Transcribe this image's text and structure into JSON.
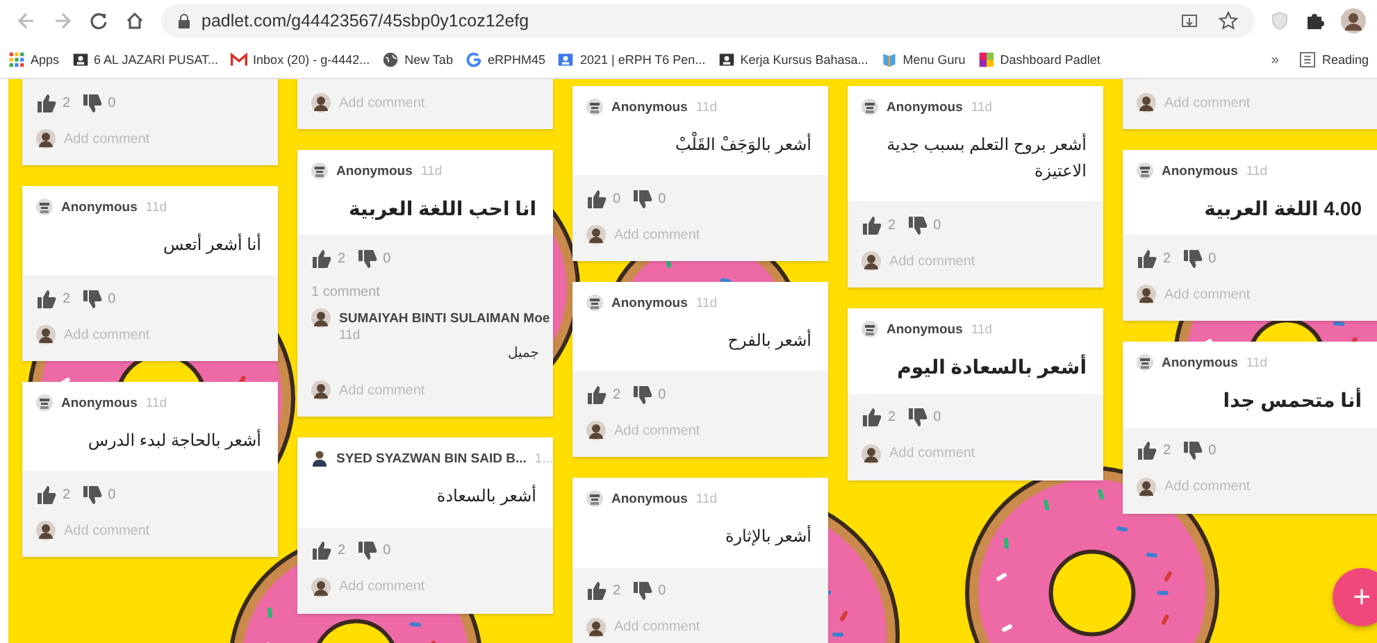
{
  "browser": {
    "url": "padlet.com/g44423567/45sbp0y1coz12efg",
    "bookmarks": [
      {
        "label": "Apps",
        "kind": "apps"
      },
      {
        "label": "6 AL JAZARI PUSAT...",
        "kind": "classroom"
      },
      {
        "label": "Inbox (20) - g-4442...",
        "kind": "mail"
      },
      {
        "label": "New Tab",
        "kind": "globe"
      },
      {
        "label": "eRPHM45",
        "kind": "google"
      },
      {
        "label": "2021 | eRPH T6 Pen...",
        "kind": "classroom-blue"
      },
      {
        "label": "Kerja Kursus Bahasa...",
        "kind": "classroom"
      },
      {
        "label": "Menu Guru",
        "kind": "book"
      },
      {
        "label": "Dashboard Padlet",
        "kind": "padlet"
      }
    ],
    "overflow": "»",
    "reading_list": "Reading"
  },
  "board": {
    "columns": [
      {
        "cards": [
          {
            "kind": "partial",
            "likes": "2",
            "dislikes": "0",
            "add_comment": "Add comment"
          },
          {
            "kind": "anonymous-post",
            "author": "Anonymous",
            "time": "11d",
            "text": "أنا أشعر أتعس",
            "bold": false,
            "likes": "2",
            "dislikes": "0",
            "add_comment": "Add comment"
          },
          {
            "kind": "anonymous-post",
            "author": "Anonymous",
            "time": "11d",
            "text": "أشعر بالحاجة لبدء الدرس",
            "bold": false,
            "likes": "2",
            "dislikes": "0",
            "add_comment": "Add comment"
          }
        ]
      },
      {
        "cards": [
          {
            "kind": "partial",
            "add_comment": "Add comment"
          },
          {
            "kind": "anonymous-post",
            "author": "Anonymous",
            "time": "11d",
            "text": "انا احب اللغة العربية",
            "bold": true,
            "likes": "2",
            "dislikes": "0",
            "comments_count": "1 comment",
            "comments": [
              {
                "author": "SUMAIYAH BINTI SULAIMAN Moe",
                "time": "11d",
                "text": "جميل"
              }
            ],
            "add_comment": "Add comment"
          },
          {
            "kind": "named-post",
            "author": "SYED SYAZWAN BIN SAID B...",
            "time": "1...",
            "text": "أشعر بالسعادة",
            "bold": false,
            "likes": "2",
            "dislikes": "0",
            "add_comment": "Add comment"
          }
        ]
      },
      {
        "cards": [
          {
            "kind": "anonymous-post",
            "author": "Anonymous",
            "time": "11d",
            "text": "أشعر بالوَجَفْ القَلْبْ",
            "bold": false,
            "likes": "0",
            "dislikes": "0",
            "add_comment": "Add comment"
          },
          {
            "kind": "anonymous-post",
            "author": "Anonymous",
            "time": "11d",
            "text": "أشعر بالفرح",
            "bold": false,
            "likes": "2",
            "dislikes": "0",
            "add_comment": "Add comment"
          },
          {
            "kind": "anonymous-post",
            "author": "Anonymous",
            "time": "11d",
            "text": "أشعر بالإثارة",
            "bold": false,
            "likes": "2",
            "dislikes": "0",
            "add_comment": "Add comment"
          }
        ]
      },
      {
        "cards": [
          {
            "kind": "anonymous-post",
            "author": "Anonymous",
            "time": "11d",
            "text": "أشعر بروح التعلم بسبب جدية الاعتيزة",
            "bold": false,
            "likes": "2",
            "dislikes": "0",
            "add_comment": "Add comment"
          },
          {
            "kind": "anonymous-post",
            "author": "Anonymous",
            "time": "11d",
            "text": "أشعر بالسعادة اليوم",
            "bold": true,
            "likes": "2",
            "dislikes": "0",
            "add_comment": "Add comment"
          }
        ]
      },
      {
        "cards": [
          {
            "kind": "partial",
            "add_comment": "Add comment"
          },
          {
            "kind": "anonymous-post",
            "author": "Anonymous",
            "time": "11d",
            "text": "4.00 اللغة العربية",
            "bold": true,
            "likes": "2",
            "dislikes": "0",
            "add_comment": "Add comment"
          },
          {
            "kind": "anonymous-post",
            "author": "Anonymous",
            "time": "11d",
            "text": "أنا متحمس جدا",
            "bold": true,
            "likes": "2",
            "dislikes": "0",
            "add_comment": "Add comment"
          }
        ]
      }
    ]
  },
  "add_button": "+"
}
